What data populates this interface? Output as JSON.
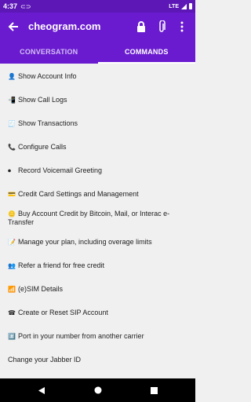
{
  "status": {
    "time": "4:37",
    "network": "LTE"
  },
  "header": {
    "title": "cheogram.com"
  },
  "tabs": [
    {
      "label": "CONVERSATION"
    },
    {
      "label": "COMMANDS"
    }
  ],
  "commands": [
    {
      "icon": "👤",
      "label": "Show Account Info"
    },
    {
      "icon": "📲",
      "label": "Show Call Logs"
    },
    {
      "icon": "🧾",
      "label": "Show Transactions"
    },
    {
      "icon": "📞",
      "label": "Configure Calls"
    },
    {
      "icon": "⏺",
      "label": "Record Voicemail Greeting"
    },
    {
      "icon": "💳",
      "label": "Credit Card Settings and Management"
    },
    {
      "icon": "🪙",
      "label": "Buy Account Credit by Bitcoin, Mail, or Interac e-Transfer"
    },
    {
      "icon": "📝",
      "label": "Manage your plan, including overage limits"
    },
    {
      "icon": "👥",
      "label": "Refer a friend for free credit"
    },
    {
      "icon": "📶",
      "label": "(e)SIM Details"
    },
    {
      "icon": "☎",
      "label": "Create or Reset SIP Account"
    },
    {
      "icon": "#️⃣",
      "label": "Port in your number from another carrier"
    },
    {
      "icon": "",
      "label": "Change your Jabber ID"
    }
  ]
}
